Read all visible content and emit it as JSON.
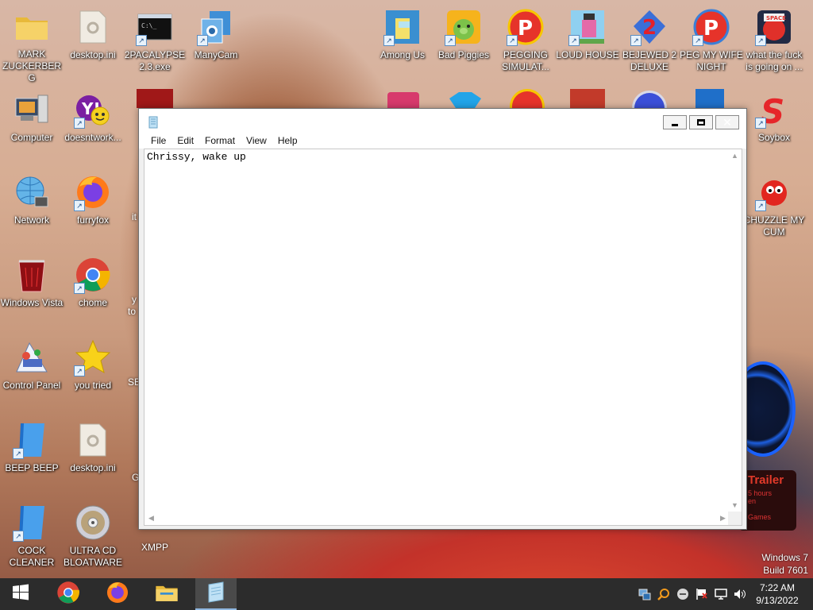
{
  "desktop": {
    "icons_left": [
      {
        "label": "MARK ZUCKERBERG",
        "icon": "folder-icon"
      },
      {
        "label": "desktop.ini",
        "icon": "settings-file-icon"
      },
      {
        "label": "2PACALYPSE 2.3.exe",
        "icon": "console-app-icon"
      },
      {
        "label": "ManyCam",
        "icon": "manycam-icon"
      },
      {
        "label": "Computer",
        "icon": "computer-icon"
      },
      {
        "label": "doesntwork...",
        "icon": "yahoo-messenger-icon"
      },
      {
        "label": "Network",
        "icon": "network-globe-icon"
      },
      {
        "label": "furryfox",
        "icon": "firefox-icon"
      },
      {
        "label": "Windows Vista",
        "icon": "red-recycle-bin-icon"
      },
      {
        "label": "chome",
        "icon": "chrome-icon"
      },
      {
        "label": "Control Panel",
        "icon": "control-panel-icon"
      },
      {
        "label": "you tried",
        "icon": "gold-star-icon"
      },
      {
        "label": "BEEP BEEP",
        "icon": "blue-book-icon"
      },
      {
        "label": "desktop.ini",
        "icon": "settings-file-icon"
      },
      {
        "label": "COCK CLEANER",
        "icon": "blue-book-icon"
      },
      {
        "label": "ULTRA CD BLOATWARE",
        "icon": "cd-disc-icon"
      }
    ],
    "partial_labels": [
      "it",
      "y",
      "to",
      "SE",
      "G",
      "XMPP"
    ],
    "icons_top": [
      {
        "label": "Among Us",
        "icon": "among-us-icon"
      },
      {
        "label": "Bad Piggies",
        "icon": "bad-piggies-icon"
      },
      {
        "label": "PEGGING SIMULAT...",
        "icon": "peggle-icon"
      },
      {
        "label": "LOUD HOUSE",
        "icon": "loud-house-icon"
      },
      {
        "label": "BEJEWED 2 DELUXE",
        "icon": "bejeweled-icon"
      },
      {
        "label": "PEG MY WIFE NIGHT",
        "icon": "peggle-icon"
      },
      {
        "label": "what the fuck is going on ...",
        "icon": "angry-birds-space-icon"
      }
    ],
    "icons_right": [
      {
        "label": "Soybox",
        "icon": "soybox-icon"
      },
      {
        "label": "CHUZZLE MY CUM",
        "icon": "chuzzle-icon"
      }
    ],
    "gadget": {
      "title": "Trailer",
      "line1": "5 hours",
      "line2": "en",
      "line3": "Games"
    },
    "watermark": {
      "line1": "Windows 7",
      "line2": "Build 7601"
    }
  },
  "notepad": {
    "menu": [
      "File",
      "Edit",
      "Format",
      "View",
      "Help"
    ],
    "content": "Chrissy, wake up",
    "controls": {
      "minimize": "minimize-icon",
      "maximize": "maximize-icon",
      "close": "close-icon"
    }
  },
  "taskbar": {
    "apps": [
      {
        "name": "start",
        "icon": "windows-logo-icon"
      },
      {
        "name": "chrome",
        "icon": "chrome-icon"
      },
      {
        "name": "firefox",
        "icon": "firefox-icon"
      },
      {
        "name": "explorer",
        "icon": "folder-icon"
      },
      {
        "name": "notepad",
        "icon": "notepad-icon",
        "active": true
      }
    ],
    "tray": [
      "network-tray-icon",
      "search-tray-icon",
      "minus-circle-icon",
      "flag-icon",
      "display-icon",
      "volume-icon"
    ],
    "time": "7:22 AM",
    "date": "9/13/2022"
  },
  "colors": {
    "taskbar": "#2c2c2c",
    "close_button": "#c83a2b",
    "window_bg": "#f0f0f0"
  }
}
